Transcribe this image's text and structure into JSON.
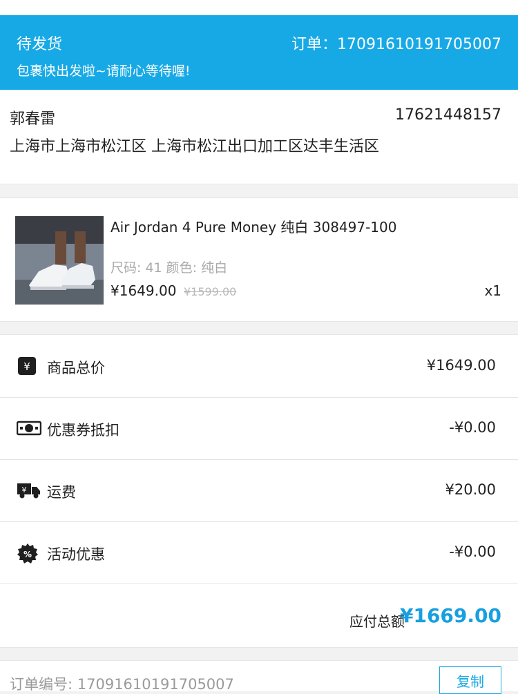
{
  "status": {
    "title": "待发货",
    "order_label": "订单：17091610191705007",
    "subtitle": "包裹快出发啦~请耐心等待喔!"
  },
  "address": {
    "name": "郭春雷",
    "phone": "17621448157",
    "line": "上海市上海市松江区 上海市松江出口加工区达丰生活区"
  },
  "product": {
    "name": "Air Jordan 4 Pure Money 纯白 308497-100",
    "spec": "尺码: 41  颜色: 纯白",
    "price": "¥1649.00",
    "original_price": "¥1599.00",
    "quantity": "x1"
  },
  "summary": {
    "rows": [
      {
        "icon": "yen-icon",
        "label": "商品总价",
        "value": "¥1649.00"
      },
      {
        "icon": "coupon-icon",
        "label": "优惠券抵扣",
        "value": "-¥0.00"
      },
      {
        "icon": "delivery-truck-icon",
        "label": "运费",
        "value": "¥20.00"
      },
      {
        "icon": "discount-badge-icon",
        "label": "活动优惠",
        "value": "-¥0.00"
      }
    ],
    "total_label": "应付总额",
    "total_value": "¥1669.00"
  },
  "order": {
    "number_text": "订单编号: 17091610191705007",
    "copy_label": "复制"
  },
  "colors": {
    "accent": "#17a9e6",
    "total_price": "#17a0e0"
  }
}
